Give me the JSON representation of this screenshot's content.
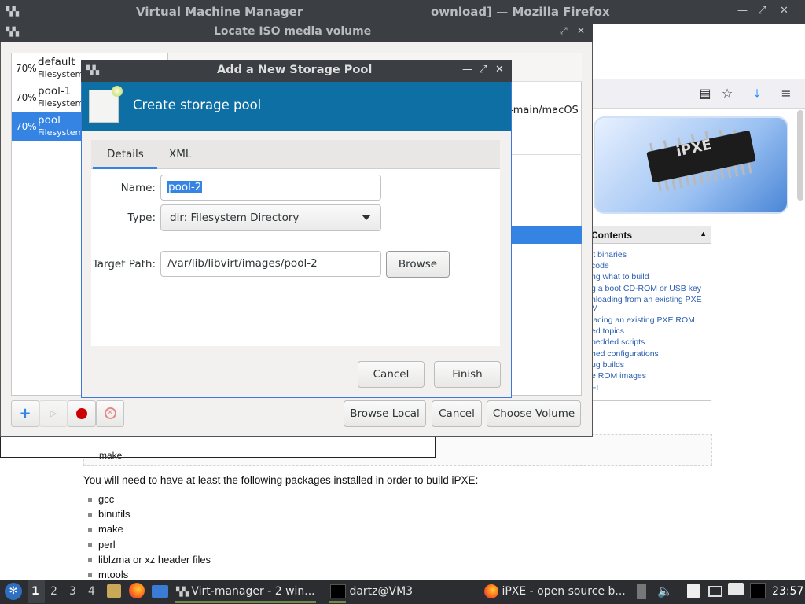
{
  "firefox": {
    "title": "ownload] — Mozilla Firefox",
    "toc_title": "Contents",
    "toc_items": [
      "lt binaries",
      "code",
      "ng what to build",
      "g a boot CD-ROM or USB key",
      "nloading from an existing PXE",
      "M",
      "lacing an existing PXE ROM",
      "ed topics",
      "bedded scripts",
      "hed configurations",
      "ug builds",
      "e ROM images",
      "FI"
    ],
    "banner_text": "iPXE",
    "partial_item": "make",
    "intro": "You will need to have at least the following packages installed in order to build iPXE:",
    "packages": [
      "gcc",
      "binutils",
      "make",
      "perl",
      "liblzma or xz header files",
      "mtools"
    ]
  },
  "vmm": {
    "title": "Virtual Machine Manager"
  },
  "iso_dialog": {
    "title": "Locate ISO media volume",
    "pools": [
      {
        "pct": "70%",
        "name": "default",
        "sub": "Filesystem"
      },
      {
        "pct": "70%",
        "name": "pool-1",
        "sub": "Filesystem"
      },
      {
        "pct": "70%",
        "name": "pool",
        "sub": "Filesystem"
      }
    ],
    "volume_path_fragment": "-main/macOS",
    "buttons": {
      "browse_local": "Browse Local",
      "cancel": "Cancel",
      "choose_volume": "Choose Volume"
    }
  },
  "pool_dialog": {
    "title": "Add a New Storage Pool",
    "header_title": "Create storage pool",
    "tabs": [
      "Details",
      "XML"
    ],
    "fields": {
      "name_label": "Name:",
      "name_value": "pool-2",
      "type_label": "Type:",
      "type_value": "dir: Filesystem Directory",
      "target_label": "Target Path:",
      "target_value": "/var/lib/libvirt/images/pool-2",
      "browse": "Browse"
    },
    "buttons": {
      "cancel": "Cancel",
      "finish": "Finish"
    }
  },
  "taskbar": {
    "workspaces": [
      "1",
      "2",
      "3",
      "4"
    ],
    "tasks": [
      {
        "label": "Virt-manager - 2 win..."
      },
      {
        "label": "dartz@VM3"
      },
      {
        "label": "iPXE - open source b..."
      }
    ],
    "clock": "23:57"
  },
  "colors": {
    "accent": "#3584e4",
    "pool_header": "#0d6fa3",
    "titlebar": "#3b3e43",
    "record_red": "#cc0000"
  }
}
